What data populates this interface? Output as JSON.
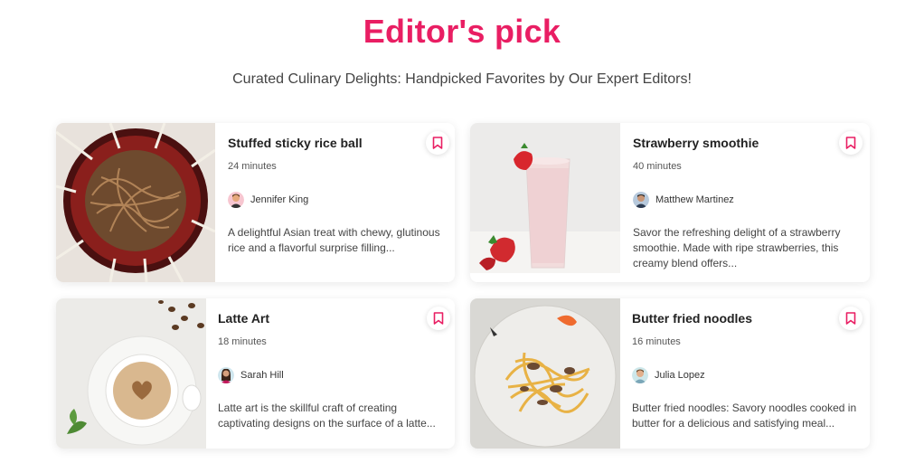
{
  "header": {
    "title": "Editor's pick",
    "subtitle": "Curated Culinary Delights: Handpicked Favorites by Our Expert Editors!"
  },
  "colors": {
    "accent": "#e91e63"
  },
  "cards": [
    {
      "name": "Stuffed sticky rice ball",
      "duration": "24 minutes",
      "author": "Jennifer King",
      "description": "A delightful Asian treat with chewy, glutinous rice and a flavorful surprise filling...",
      "image": "noodle-bowl-with-chopsticks"
    },
    {
      "name": "Strawberry smoothie",
      "duration": "40 minutes",
      "author": "Matthew Martinez",
      "description": "Savor the refreshing delight of a strawberry smoothie. Made with ripe strawberries, this creamy blend offers...",
      "image": "strawberry-smoothie-glass"
    },
    {
      "name": "Latte Art",
      "duration": "18 minutes",
      "author": "Sarah Hill",
      "description": "Latte art is the skillful craft of creating captivating designs on the surface of a latte...",
      "image": "latte-cup-with-heart"
    },
    {
      "name": "Butter fried noodles",
      "duration": "16 minutes",
      "author": "Julia Lopez",
      "description": "Butter fried noodles: Savory noodles cooked in butter for a delicious and satisfying meal...",
      "image": "pasta-with-mushrooms"
    }
  ]
}
